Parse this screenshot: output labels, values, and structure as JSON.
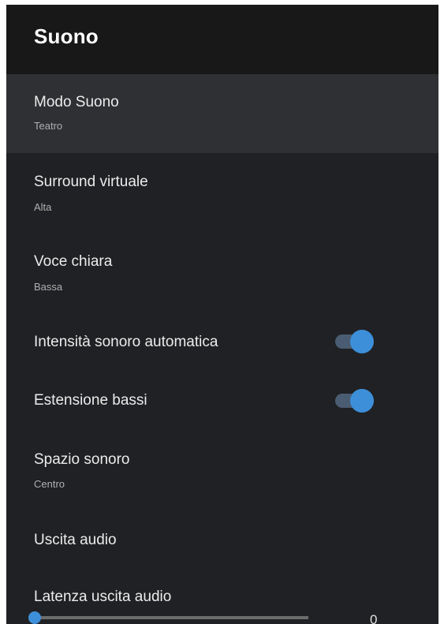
{
  "header": {
    "title": "Suono"
  },
  "items": [
    {
      "label": "Modo Suono",
      "value": "Teatro"
    },
    {
      "label": "Surround virtuale",
      "value": "Alta"
    },
    {
      "label": "Voce chiara",
      "value": "Bassa"
    },
    {
      "label": "Intensità sonoro automatica",
      "toggle_on": true
    },
    {
      "label": "Estensione bassi",
      "toggle_on": true
    },
    {
      "label": "Spazio sonoro",
      "value": "Centro"
    },
    {
      "label": "Uscita audio"
    },
    {
      "label": "Latenza uscita audio",
      "slider_value": "0",
      "slider_level": 0
    }
  ],
  "colors": {
    "panel_bg": "#202124",
    "header_bg": "#181818",
    "selected_bg": "#2f3033",
    "accent": "#3d8fd9",
    "toggle_track": "#4a5c71"
  }
}
